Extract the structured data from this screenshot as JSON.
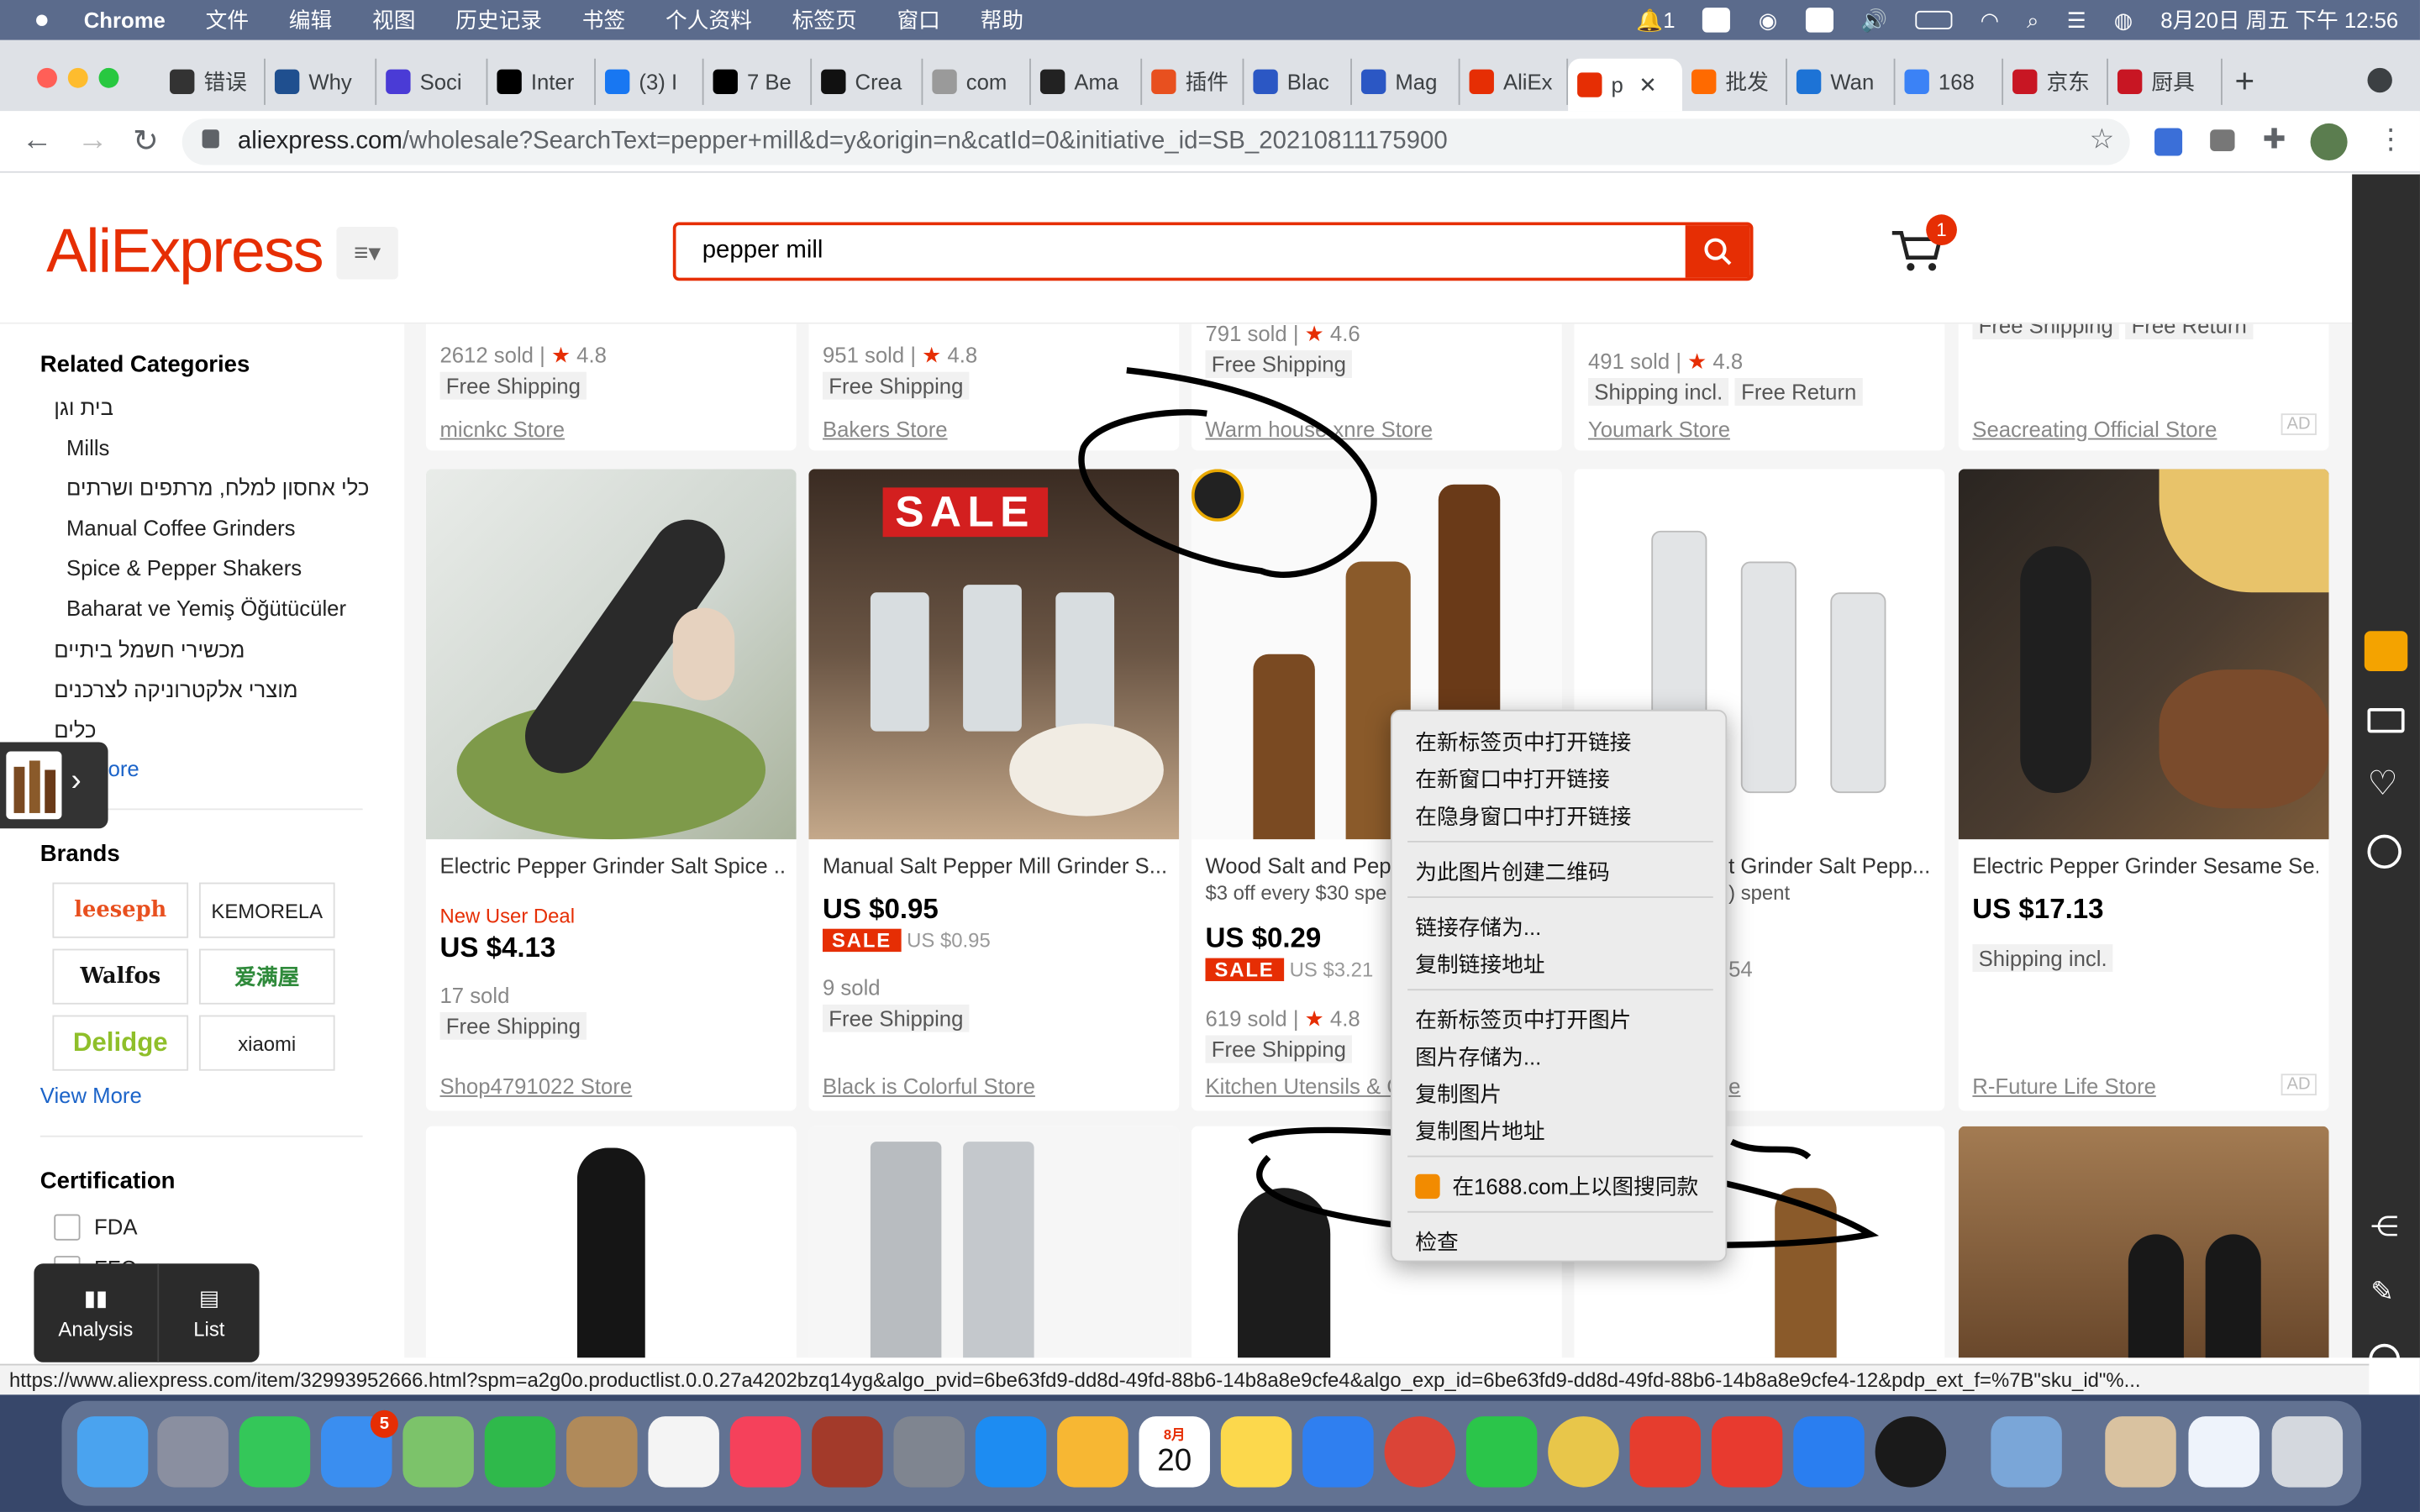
{
  "os_menubar": {
    "app": "Chrome",
    "items": [
      "文件",
      "编辑",
      "视图",
      "历史记录",
      "书签",
      "个人资料",
      "标签页",
      "窗口",
      "帮助"
    ],
    "notification_count": "1",
    "datetime": "8月20日 周五 下午 12:56"
  },
  "browser": {
    "tabs": [
      {
        "label": "错误",
        "icon": "github-icon",
        "color": "#333333"
      },
      {
        "label": "Why",
        "icon": "generic-icon",
        "color": "#1f4f8f"
      },
      {
        "label": "Soci",
        "icon": "circle-icon",
        "color": "#4a3bd6"
      },
      {
        "label": "Inter",
        "icon": "grid-icon",
        "color": "#000000"
      },
      {
        "label": "(3) I",
        "icon": "facebook-icon",
        "color": "#1877f2"
      },
      {
        "label": "7 Be",
        "icon": "m-icon",
        "color": "#000000"
      },
      {
        "label": "Crea",
        "icon": "tiktok-icon",
        "color": "#111111"
      },
      {
        "label": "com",
        "icon": "fire-icon",
        "color": "#9a9a9a"
      },
      {
        "label": "Ama",
        "icon": "amazon-icon",
        "color": "#222222"
      },
      {
        "label": "插件",
        "icon": "s-icon",
        "color": "#e8501f"
      },
      {
        "label": "Blac",
        "icon": "chart-icon",
        "color": "#2b57c4"
      },
      {
        "label": "Mag",
        "icon": "chart-icon",
        "color": "#2b57c4"
      },
      {
        "label": "AliEx",
        "icon": "aliexpress-icon",
        "color": "#e62e04"
      },
      {
        "label": "p",
        "icon": "aliexpress-icon",
        "color": "#e62e04",
        "active": true
      },
      {
        "label": "批发",
        "icon": "alibaba-icon",
        "color": "#ff6a00"
      },
      {
        "label": "Wan",
        "icon": "cb-icon",
        "color": "#1d73d6"
      },
      {
        "label": "168",
        "icon": "doc-icon",
        "color": "#3b82f6"
      },
      {
        "label": "京东",
        "icon": "jd-icon",
        "color": "#c81623"
      },
      {
        "label": "厨具",
        "icon": "jd-icon",
        "color": "#c81623"
      }
    ],
    "url_host": "aliexpress.com",
    "url_path": "/wholesale?SearchText=pepper+mill&d=y&origin=n&catId=0&initiative_id=SB_20210811175900",
    "status_url": "https://www.aliexpress.com/item/32993952666.html?spm=a2g0o.productlist.0.0.27a4202bzq14yg&algo_pvid=6be63fd9-dd8d-49fd-88b6-14b8a8e9cfe4&algo_exp_id=6be63fd9-dd8d-49fd-88b6-14b8a8e9cfe4-12&pdp_ext_f=%7B\"sku_id\"%..."
  },
  "site": {
    "logo": "AliExpress",
    "search_value": "pepper mill",
    "cart_count": "1",
    "accent": "#e62e04"
  },
  "sidebar": {
    "related_title": "Related Categories",
    "categories": [
      "בית וגן",
      "Mills",
      "כלי אחסון למלח, מרתפים ושרתים",
      "Manual Coffee Grinders",
      "Spice & Pepper Shakers",
      "Baharat ve Yemiş Öğütücüler",
      "מכשירי חשמל ביתיים",
      "מוצרי אלקטרוניקה לצרכנים",
      "כלים"
    ],
    "see_more": "ore",
    "brands_title": "Brands",
    "brands": [
      "leeseph",
      "KEMORELA",
      "Walfos",
      "爱满屋",
      "Delidge",
      "xiaomi"
    ],
    "view_more": "View More",
    "cert_title": "Certification",
    "cert_items": [
      "FDA",
      "FFC"
    ]
  },
  "top_row": [
    {
      "sold": "2612 sold",
      "rating": "4.8",
      "tags": [
        "Free Shipping"
      ],
      "store": "micnkc Store"
    },
    {
      "sold": "951 sold",
      "rating": "4.8",
      "tags": [
        "Free Shipping"
      ],
      "store": "Bakers Store"
    },
    {
      "sold": "791 sold",
      "rating": "4.6",
      "tags": [
        "Free Shipping"
      ],
      "store": "Warm house xnre Store"
    },
    {
      "sold": "491 sold",
      "rating": "4.8",
      "tags": [
        "Shipping incl.",
        "Free Return"
      ],
      "store": "Youmark Store"
    },
    {
      "sold": "",
      "rating": "",
      "tags": [
        "Free Shipping",
        "Free Return"
      ],
      "store": "Seacreating Official Store",
      "ad": "AD"
    }
  ],
  "products": [
    {
      "title": "Electric Pepper Grinder Salt Spice ...",
      "deal": "New User Deal",
      "price": "US $4.13",
      "sold": "17 sold",
      "shipping": "Free Shipping",
      "store": "Shop4791022 Store"
    },
    {
      "title": "Manual Salt Pepper Mill Grinder S...",
      "price": "US $0.95",
      "sale": "SALE",
      "orig": "US $0.95",
      "sold": "9 sold",
      "shipping": "Free Shipping",
      "store": "Black is Colorful Store",
      "img_text": "SALE"
    },
    {
      "title": "Wood Salt and Pepp",
      "promo": "$3 off every $30 spe",
      "price": "US $0.29",
      "sale": "SALE",
      "orig": "US $3.21",
      "sold": "619 sold",
      "rating": "4.8",
      "shipping": "Free Shipping",
      "store": "Kitchen Utensils & C"
    },
    {
      "title": "t Grinder Salt Pepp...",
      "promo": ") spent",
      "sold": "54",
      "store": "e"
    },
    {
      "title": "Electric Pepper Grinder Sesame Se...",
      "price": "US $17.13",
      "shipping": "Shipping incl.",
      "store": "R-Future Life Store",
      "ad": "AD"
    }
  ],
  "context_menu": {
    "items": [
      "在新标签页中打开链接",
      "在新窗口中打开链接",
      "在隐身窗口中打开链接",
      "为此图片创建二维码",
      "链接存储为...",
      "复制链接地址",
      "在新标签页中打开图片",
      "图片存储为...",
      "复制图片",
      "复制图片地址",
      "在1688.com上以图搜同款",
      "检查"
    ]
  },
  "analysis_panel": {
    "analysis": "Analysis",
    "list": "List"
  },
  "dock": {
    "mail_badge": "5",
    "calendar_month": "8月",
    "calendar_day": "20"
  }
}
